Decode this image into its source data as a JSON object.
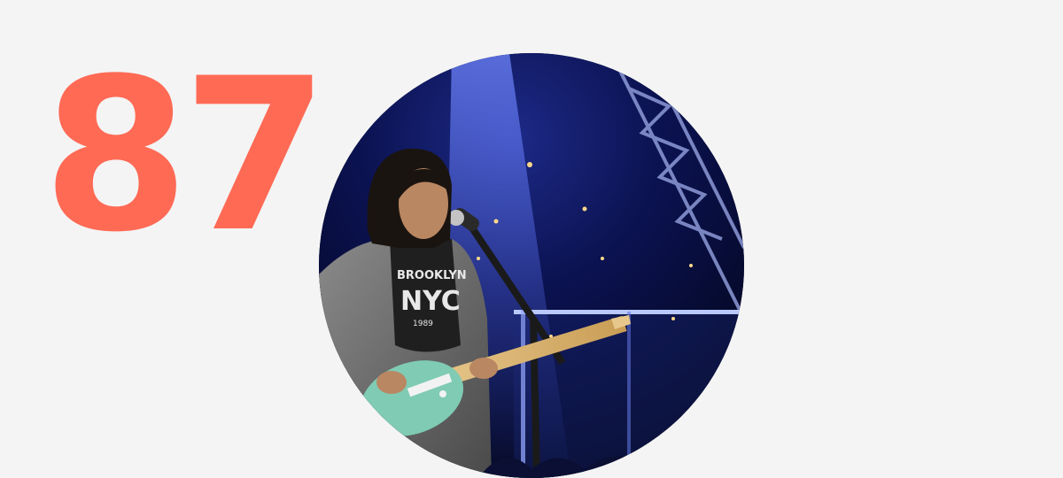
{
  "rank": {
    "number": "87",
    "color": "#ff6a55"
  },
  "photo": {
    "subject": "musician-performing-on-stage",
    "shirt_text": {
      "line1": "BROOKLYN",
      "line2": "NYC",
      "line3": "1989"
    }
  },
  "colors": {
    "background": "#f4f4f4",
    "stage_dark": "#050a2a",
    "stage_light": "#2e3fa8",
    "guitar_body": "#7fcbb3"
  }
}
